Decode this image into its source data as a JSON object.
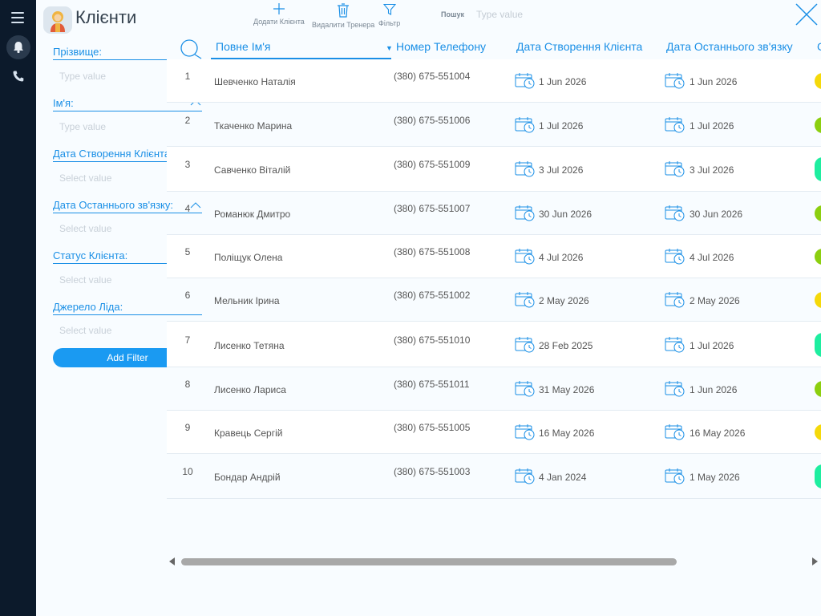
{
  "header": {
    "title": "Клієнти",
    "actions": {
      "add": "Додати Клієнта",
      "delete": "Видалити Тренера",
      "filter": "Фільтр"
    },
    "search_label": "Пошук",
    "search_placeholder": "Type value"
  },
  "filters": [
    {
      "label": "Прізвище:",
      "placeholder": "Type value"
    },
    {
      "label": "Ім'я:",
      "placeholder": "Type value"
    },
    {
      "label": "Дата Створення Клієнта:",
      "placeholder": "Select value"
    },
    {
      "label": "Дата Останнього зв'язку:",
      "placeholder": "Select value"
    },
    {
      "label": "Статус Клієнта:",
      "placeholder": "Select value"
    },
    {
      "label": "Джерело Ліда:",
      "placeholder": "Select value"
    }
  ],
  "add_filter_label": "Add Filter",
  "table": {
    "columns": [
      "Повне Ім'я",
      "Номер Телефону",
      "Дата Створення Клієнта",
      "Дата Останнього зв'язку",
      "С"
    ],
    "sort_indicator": "▼",
    "rows": [
      {
        "idx": "1",
        "name": "Шевченко Наталія",
        "phone": "(380) 675-551004",
        "created": "1 Jun 2026",
        "last": "1 Jun 2026",
        "status_color": "#f5d90a"
      },
      {
        "idx": "2",
        "name": "Ткаченко Марина",
        "phone": "(380) 675-551006",
        "created": "1 Jul 2026",
        "last": "1 Jul 2026",
        "status_color": "#8ccf0f"
      },
      {
        "idx": "3",
        "name": "Савченко Віталій",
        "phone": "(380) 675-551009",
        "created": "3 Jul 2026",
        "last": "3 Jul 2026",
        "status_color": "#1eeea0"
      },
      {
        "idx": "4",
        "name": "Романюк Дмитро",
        "phone": "(380) 675-551007",
        "created": "30 Jun 2026",
        "last": "30 Jun 2026",
        "status_color": "#8ccf0f"
      },
      {
        "idx": "5",
        "name": "Поліщук Олена",
        "phone": "(380) 675-551008",
        "created": "4 Jul 2026",
        "last": "4 Jul 2026",
        "status_color": "#8ccf0f"
      },
      {
        "idx": "6",
        "name": "Мельник Ірина",
        "phone": "(380) 675-551002",
        "created": "2 May 2026",
        "last": "2 May 2026",
        "status_color": "#f5d90a"
      },
      {
        "idx": "7",
        "name": "Лисенко Тетяна",
        "phone": "(380) 675-551010",
        "created": "28 Feb 2025",
        "last": "1 Jul 2026",
        "status_color": "#1eeea0"
      },
      {
        "idx": "8",
        "name": "Лисенко Лариса",
        "phone": "(380) 675-551011",
        "created": "31 May 2026",
        "last": "1 Jun 2026",
        "status_color": "#8ccf0f"
      },
      {
        "idx": "9",
        "name": "Кравець Сергій",
        "phone": "(380) 675-551005",
        "created": "16 May 2026",
        "last": "16 May 2026",
        "status_color": "#f5d90a"
      },
      {
        "idx": "10",
        "name": "Бондар Андрій",
        "phone": "(380) 675-551003",
        "created": "4 Jan 2024",
        "last": "1 May 2026",
        "status_color": "#1eeea0"
      }
    ]
  },
  "colors": {
    "accent": "#1a8fe6",
    "rail": "#0c1a2b",
    "button": "#1a9af2"
  },
  "icons": [
    "menu-icon",
    "bell-icon",
    "phone-icon",
    "add-icon",
    "trash-icon",
    "filter-icon",
    "close-icon",
    "search-icon",
    "calendar-clock-icon",
    "chevron-up-icon"
  ]
}
